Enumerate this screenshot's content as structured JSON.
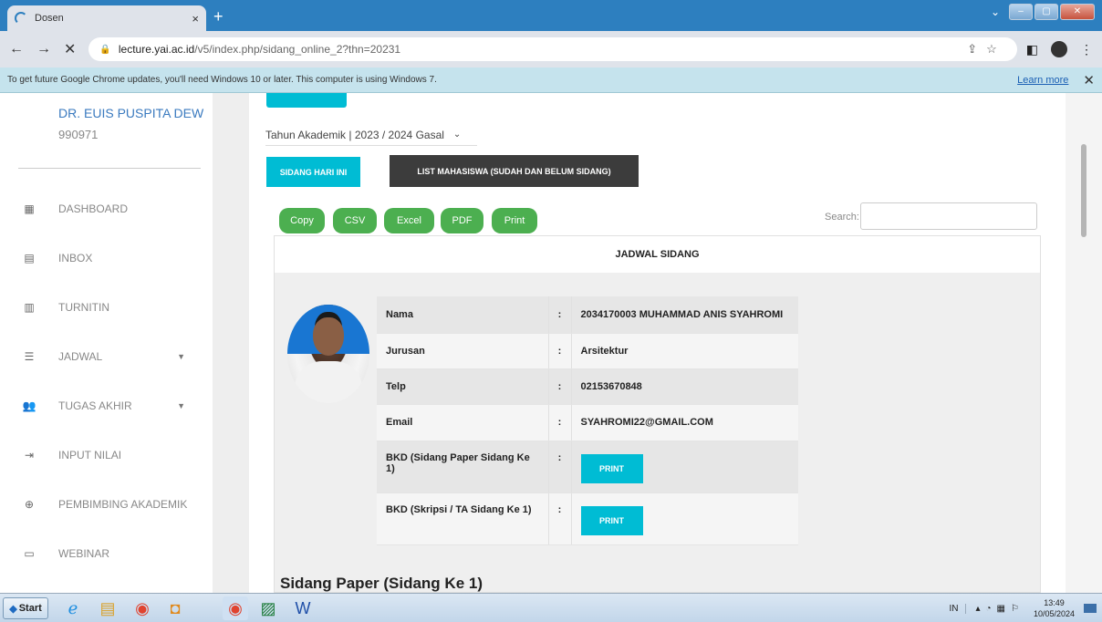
{
  "browser": {
    "tab_title": "Dosen",
    "tab_close": "×",
    "new_tab": "+",
    "url_host": "lecture.yai.ac.id",
    "url_path": "/v5/index.php/sidang_online_2?thn=20231",
    "nav_back": "←",
    "nav_forward": "→",
    "nav_stop": "✕",
    "infobar_text": "To get future Google Chrome updates, you'll need Windows 10 or later. This computer is using Windows 7.",
    "infobar_link": "Learn more",
    "infobar_close": "✕"
  },
  "sidebar": {
    "user_name": "DR. EUIS PUSPITA DEWI, I",
    "user_id": "990971",
    "items": [
      {
        "label": "DASHBOARD",
        "icon": "dashboard-icon"
      },
      {
        "label": "INBOX",
        "icon": "inbox-icon"
      },
      {
        "label": "TURNITIN",
        "icon": "document-icon"
      },
      {
        "label": "JADWAL",
        "icon": "list-icon",
        "has_caret": true
      },
      {
        "label": "TUGAS AKHIR",
        "icon": "people-icon",
        "has_caret": true
      },
      {
        "label": "INPUT NILAI",
        "icon": "input-icon"
      },
      {
        "label": "PEMBIMBING AKADEMIK",
        "icon": "globe-icon"
      },
      {
        "label": "WEBINAR",
        "icon": "webinar-icon"
      }
    ]
  },
  "main": {
    "academic_year_select": "Tahun Akademik | 2023 / 2024 Gasal",
    "btn_today": "SIDANG HARI INI",
    "btn_list": "LIST MAHASISWA (SUDAH DAN BELUM SIDANG)",
    "export_buttons": [
      "Copy",
      "CSV",
      "Excel",
      "PDF",
      "Print"
    ],
    "search_label": "Search:",
    "panel_title": "JADWAL SIDANG",
    "student": {
      "rows": [
        {
          "label": "Nama",
          "sep": ":",
          "value": "2034170003 MUHAMMAD ANIS SYAHROMI"
        },
        {
          "label": "Jurusan",
          "sep": ":",
          "value": "Arsitektur"
        },
        {
          "label": "Telp",
          "sep": ":",
          "value": "02153670848"
        },
        {
          "label": "Email",
          "sep": ":",
          "value": "SYAHROMI22@GMAIL.COM"
        },
        {
          "label": "BKD (Sidang Paper Sidang Ke 1)",
          "sep": ":",
          "button": "PRINT"
        },
        {
          "label": "BKD (Skripsi / TA Sidang Ke 1)",
          "sep": ":",
          "button": "PRINT"
        }
      ]
    },
    "section_title": "Sidang Paper (Sidang Ke 1)"
  },
  "taskbar": {
    "start_label": "Start",
    "lang": "IN",
    "time": "13:49",
    "date": "10/05/2024"
  },
  "colors": {
    "accent_cyan": "#00bcd4",
    "export_green": "#4caf50",
    "dark_button": "#3c3c3c",
    "chrome_blue": "#2d7fbf"
  }
}
